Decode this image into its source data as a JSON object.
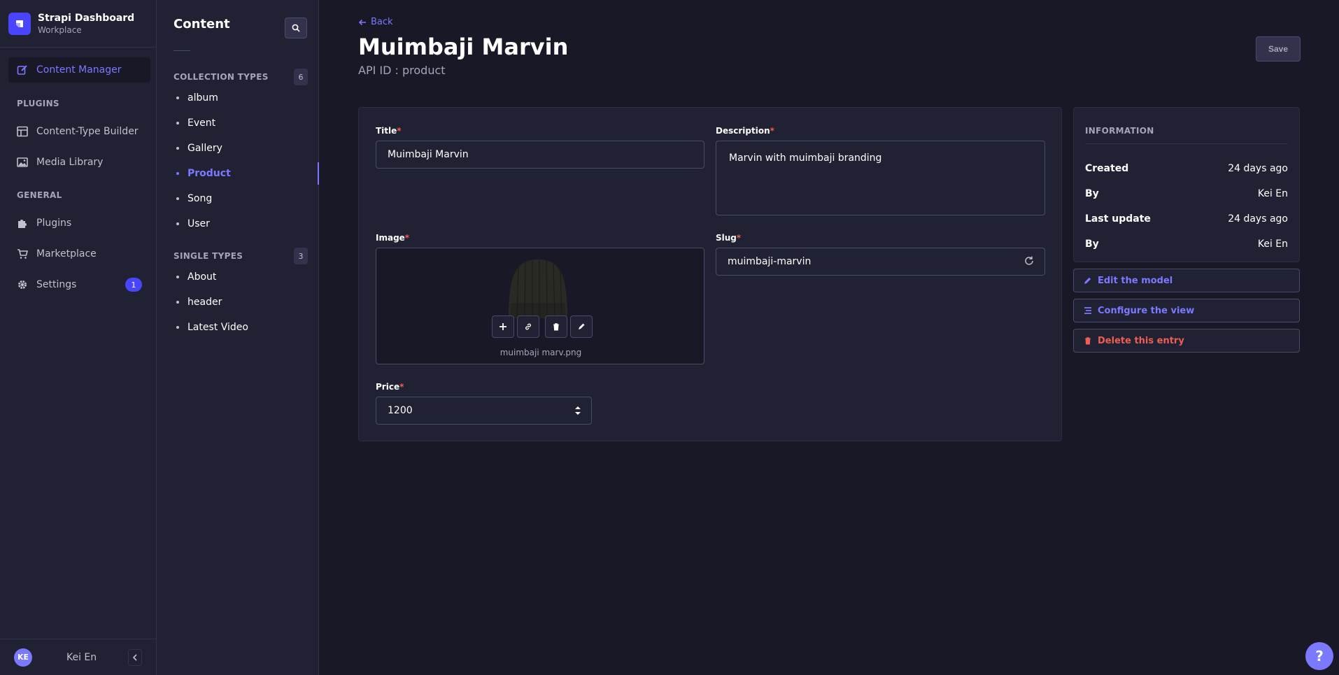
{
  "brand": {
    "title": "Strapi Dashboard",
    "subtitle": "Workplace"
  },
  "nav": {
    "content_manager": "Content Manager",
    "plugins_section": "PLUGINS",
    "content_type_builder": "Content-Type Builder",
    "media_library": "Media Library",
    "general_section": "GENERAL",
    "plugins": "Plugins",
    "marketplace": "Marketplace",
    "settings": "Settings",
    "settings_badge": "1"
  },
  "user": {
    "initials": "KE",
    "name": "Kei En"
  },
  "subnav": {
    "title": "Content",
    "collection_label": "COLLECTION TYPES",
    "collection_count": "6",
    "collection_items": [
      "album",
      "Event",
      "Gallery",
      "Product",
      "Song",
      "User"
    ],
    "single_label": "SINGLE TYPES",
    "single_count": "3",
    "single_items": [
      "About",
      "header",
      "Latest Video"
    ]
  },
  "header": {
    "back": "Back",
    "title": "Muimbaji Marvin",
    "api_id": "API ID : product",
    "save": "Save"
  },
  "form": {
    "title_label": "Title",
    "title_value": "Muimbaji Marvin",
    "description_label": "Description",
    "description_value": "Marvin with muimbaji branding",
    "image_label": "Image",
    "image_filename": "muimbaji marv.png",
    "slug_label": "Slug",
    "slug_value": "muimbaji-marvin",
    "price_label": "Price",
    "price_value": "1200",
    "required_mark": "*"
  },
  "info": {
    "heading": "INFORMATION",
    "created_label": "Created",
    "created_value": "24 days ago",
    "by_label": "By",
    "created_by": "Kei En",
    "updated_label": "Last update",
    "updated_value": "24 days ago",
    "updated_by": "Kei En"
  },
  "actions": {
    "edit_model": "Edit the model",
    "configure_view": "Configure the view",
    "delete_entry": "Delete this entry"
  },
  "help": "?",
  "colors": {
    "accent": "#7b79ff",
    "danger": "#ee5e52",
    "background": "#181826",
    "surface": "#212134"
  }
}
